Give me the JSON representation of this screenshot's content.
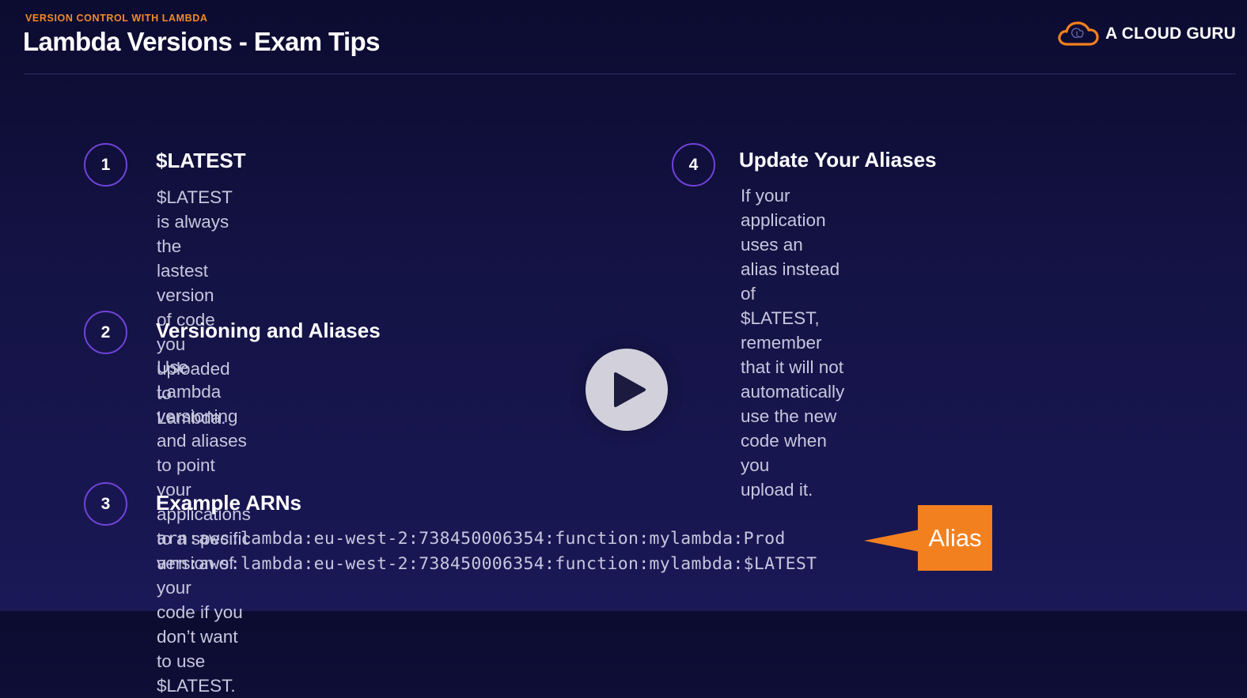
{
  "header": {
    "eyebrow": "VERSION CONTROL WITH LAMBDA",
    "title": "Lambda Versions - Exam Tips",
    "logo_text": "A CLOUD GURU",
    "logo_icon": "cloud-brain-icon"
  },
  "tips": [
    {
      "number": "1",
      "heading": "$LATEST",
      "body_lines": [
        "$LATEST is always the lastest version of code",
        "you uploaded to Lambda."
      ]
    },
    {
      "number": "2",
      "heading": "Versioning and Aliases",
      "body_lines": [
        "Use Lambda versioning and aliases to point",
        "your applications to a specific version of your",
        "code if you don’t want to use $LATEST."
      ]
    },
    {
      "number": "3",
      "heading": "Example ARNs",
      "arns": [
        "arn:aws:lambda:eu-west-2:738450006354:function:mylambda:Prod",
        "arn:aws:lambda:eu-west-2:738450006354:function:mylambda:$LATEST"
      ]
    },
    {
      "number": "4",
      "heading": "Update Your Aliases",
      "body_lines": [
        "If your application uses an alias instead of",
        "$LATEST, remember that it will not",
        "automatically use the new code when you",
        "upload it."
      ]
    }
  ],
  "callout": {
    "label": "Alias"
  },
  "player": {
    "play_icon": "play-icon"
  },
  "colors": {
    "accent_orange": "#f3801f",
    "circle_purple": "#7043d6",
    "background": "#141345"
  }
}
